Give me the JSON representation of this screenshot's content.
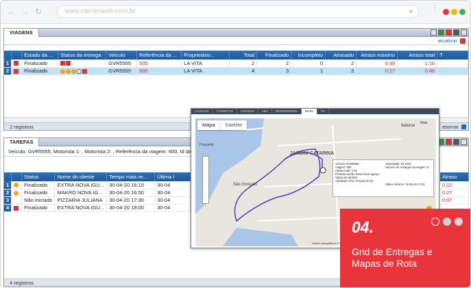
{
  "browser": {
    "url": "www.carrierweb.com.br",
    "dot_colors": [
      "#e8343a",
      "#f5b800",
      "#3bb54a"
    ]
  },
  "viagens": {
    "title": "VIAGENS",
    "refresh_label": "atualizar",
    "columns": [
      "Estado da ...",
      "Status da entrega",
      "Veículo",
      "Referência da ...",
      "Proprietário...",
      "Total",
      "Finalizado",
      "Incompleto",
      "Atrasado",
      "Atraso máximo",
      "Atraso total",
      "T"
    ],
    "rows": [
      {
        "num": "1",
        "estado": "Finalizado",
        "veiculo": "GVR5555",
        "referencia": "505",
        "proprietario": "LA VITA",
        "total": "2",
        "finalizado": "2",
        "incompleto": "0",
        "atrasado": "2",
        "atraso_max": "0:39",
        "atraso_total": "1:16"
      },
      {
        "num": "2",
        "estado": "Finalizado",
        "veiculo": "GVR5555",
        "referencia": "600",
        "proprietario": "LA VITA",
        "total": "4",
        "finalizado": "3",
        "incompleto": "1",
        "atrasado": "3",
        "atraso_max": "0:27",
        "atraso_total": "0:46"
      }
    ],
    "footer": "2 registros",
    "footer_right": "etornar"
  },
  "tarefas": {
    "title": "TAREFAS",
    "subheader": "Veículo: GVR5555, Motorista 1: , Motorista 2: , Referência da viagem: 600, Id da via",
    "columns": [
      "Status",
      "Nome do cliente",
      "Tempo mais re...",
      "Última I"
    ],
    "right_column": "Atraso",
    "rows": [
      {
        "num": "1",
        "status": "Finalizado",
        "cliente": "EXTRA NOVA IGU...",
        "tempo": "30-04-20 16:10",
        "ultima": "30-04",
        "atraso": "0:12"
      },
      {
        "num": "2",
        "status": "Finalizado",
        "cliente": "MAKRO NOVA IG...",
        "tempo": "30-04-20 16:50",
        "ultima": "30-04",
        "atraso": "0:27"
      },
      {
        "num": "3",
        "status": "Não iniciado",
        "cliente": "PIZZARIA JULIANA",
        "tempo": "30-04-20 17:30",
        "ultima": "30-04",
        "atraso": "0:07"
      },
      {
        "num": "4",
        "status": "Finalizado",
        "cliente": "EXTRA NOVA IGU...",
        "tempo": "30-04-20 18:00",
        "ultima": "30-04",
        "atraso": ""
      }
    ],
    "footer": "4 registros",
    "footer_right": "etornar"
  },
  "map": {
    "tabs": [
      "CAVALOS",
      "CARRETAS",
      "VIAGENS",
      "ABS",
      "DESEMPENHO",
      "MAPA",
      "PA"
    ],
    "type_map": "Mapa",
    "type_satellite": "Satélite",
    "places": [
      "Paquetá",
      "JARDIM CATARINA",
      "São Gonçalo",
      "Itaboraí",
      "Mais"
    ],
    "info": {
      "line1": "Veículo: GVR5555",
      "line2": "Viagem: 600",
      "line3": "Atraso total: 0:46",
      "line4": "Próxima tarefa: Extra Nova Iguaçu",
      "line5": "Status de tarefas:",
      "line6": "Atividade GPS: Parado (0:44)",
      "right1": "Velocidade: 62 km/h",
      "right2": "Número de entregas da viagem: 5",
      "right3": "Último informe: 02-05-20 17:01"
    },
    "footer": "Dados cartográficos ©2020"
  },
  "promo": {
    "number": "04.",
    "title": "Grid de Entregas e Mapas de Rota"
  }
}
